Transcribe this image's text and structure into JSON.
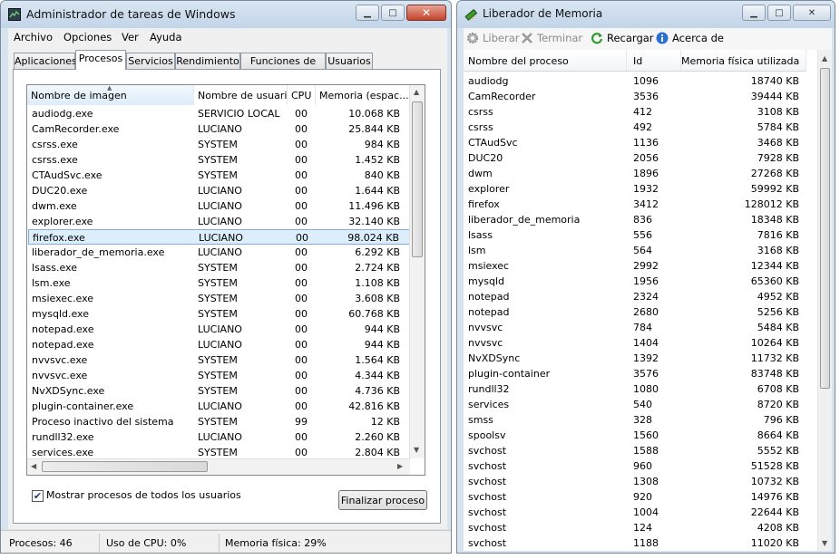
{
  "task_manager": {
    "title": "Administrador de tareas de Windows",
    "menu": [
      "Archivo",
      "Opciones",
      "Ver",
      "Ayuda"
    ],
    "tabs": [
      "Aplicaciones",
      "Procesos",
      "Servicios",
      "Rendimiento",
      "Funciones de red",
      "Usuarios"
    ],
    "active_tab": "Procesos",
    "columns": [
      "Nombre de imagen",
      "Nombre de usuario",
      "CPU",
      "Memoria (espac..."
    ],
    "rows": [
      [
        "audiodg.exe",
        "SERVICIO LOCAL",
        "00",
        "10.068 KB"
      ],
      [
        "CamRecorder.exe",
        "LUCIANO",
        "00",
        "25.844 KB"
      ],
      [
        "csrss.exe",
        "SYSTEM",
        "00",
        "984 KB"
      ],
      [
        "csrss.exe",
        "SYSTEM",
        "00",
        "1.452 KB"
      ],
      [
        "CTAudSvc.exe",
        "SYSTEM",
        "00",
        "840 KB"
      ],
      [
        "DUC20.exe",
        "LUCIANO",
        "00",
        "1.644 KB"
      ],
      [
        "dwm.exe",
        "LUCIANO",
        "00",
        "11.496 KB"
      ],
      [
        "explorer.exe",
        "LUCIANO",
        "00",
        "32.140 KB"
      ],
      [
        "firefox.exe",
        "LUCIANO",
        "00",
        "98.024 KB"
      ],
      [
        "liberador_de_memoria.exe",
        "LUCIANO",
        "00",
        "6.292 KB"
      ],
      [
        "lsass.exe",
        "SYSTEM",
        "00",
        "2.724 KB"
      ],
      [
        "lsm.exe",
        "SYSTEM",
        "00",
        "1.108 KB"
      ],
      [
        "msiexec.exe",
        "SYSTEM",
        "00",
        "3.608 KB"
      ],
      [
        "mysqld.exe",
        "SYSTEM",
        "00",
        "60.768 KB"
      ],
      [
        "notepad.exe",
        "LUCIANO",
        "00",
        "944 KB"
      ],
      [
        "notepad.exe",
        "LUCIANO",
        "00",
        "944 KB"
      ],
      [
        "nvvsvc.exe",
        "SYSTEM",
        "00",
        "1.564 KB"
      ],
      [
        "nvvsvc.exe",
        "SYSTEM",
        "00",
        "4.344 KB"
      ],
      [
        "NvXDSync.exe",
        "SYSTEM",
        "00",
        "4.736 KB"
      ],
      [
        "plugin-container.exe",
        "LUCIANO",
        "00",
        "42.816 KB"
      ],
      [
        "Proceso inactivo del sistema",
        "SYSTEM",
        "99",
        "12 KB"
      ],
      [
        "rundll32.exe",
        "LUCIANO",
        "00",
        "2.260 KB"
      ],
      [
        "services.exe",
        "SYSTEM",
        "00",
        "2.804 KB"
      ]
    ],
    "selected_row": 8,
    "show_all_label": "Mostrar procesos de todos los usuarios",
    "show_all_checked": true,
    "end_process_label": "Finalizar proceso",
    "status": {
      "processes": "Procesos: 46",
      "cpu": "Uso de CPU: 0%",
      "memory": "Memoria física: 29%"
    }
  },
  "liberador": {
    "title": "Liberador de Memoria",
    "toolbar": {
      "liberar": "Liberar",
      "terminar": "Terminar",
      "recargar": "Recargar",
      "acerca": "Acerca de"
    },
    "columns": [
      "Nombre del proceso",
      "Id",
      "Memoria física utilizada"
    ],
    "rows": [
      [
        "audiodg",
        "1096",
        "18740 KB"
      ],
      [
        "CamRecorder",
        "3536",
        "39444 KB"
      ],
      [
        "csrss",
        "412",
        "3108 KB"
      ],
      [
        "csrss",
        "492",
        "5784 KB"
      ],
      [
        "CTAudSvc",
        "1136",
        "3468 KB"
      ],
      [
        "DUC20",
        "2056",
        "7928 KB"
      ],
      [
        "dwm",
        "1896",
        "27268 KB"
      ],
      [
        "explorer",
        "1932",
        "59992 KB"
      ],
      [
        "firefox",
        "3412",
        "128012 KB"
      ],
      [
        "liberador_de_memoria",
        "836",
        "18348 KB"
      ],
      [
        "lsass",
        "556",
        "7816 KB"
      ],
      [
        "lsm",
        "564",
        "3168 KB"
      ],
      [
        "msiexec",
        "2992",
        "12344 KB"
      ],
      [
        "mysqld",
        "1956",
        "65360 KB"
      ],
      [
        "notepad",
        "2324",
        "4952 KB"
      ],
      [
        "notepad",
        "2680",
        "5256 KB"
      ],
      [
        "nvvsvc",
        "784",
        "5484 KB"
      ],
      [
        "nvvsvc",
        "1404",
        "10264 KB"
      ],
      [
        "NvXDSync",
        "1392",
        "11732 KB"
      ],
      [
        "plugin-container",
        "3576",
        "83748 KB"
      ],
      [
        "rundll32",
        "1080",
        "6708 KB"
      ],
      [
        "services",
        "540",
        "8720 KB"
      ],
      [
        "smss",
        "328",
        "796 KB"
      ],
      [
        "spoolsv",
        "1560",
        "8664 KB"
      ],
      [
        "svchost",
        "1588",
        "5552 KB"
      ],
      [
        "svchost",
        "960",
        "51528 KB"
      ],
      [
        "svchost",
        "1308",
        "10732 KB"
      ],
      [
        "svchost",
        "920",
        "14976 KB"
      ],
      [
        "svchost",
        "1004",
        "22644 KB"
      ],
      [
        "svchost",
        "124",
        "4208 KB"
      ],
      [
        "svchost",
        "1188",
        "11020 KB"
      ]
    ]
  },
  "colors": {
    "selection": "#dceefc",
    "selection_border": "#84acdd",
    "close_button": "#c2422c",
    "title_gradient_top": "#d9e6f3"
  }
}
